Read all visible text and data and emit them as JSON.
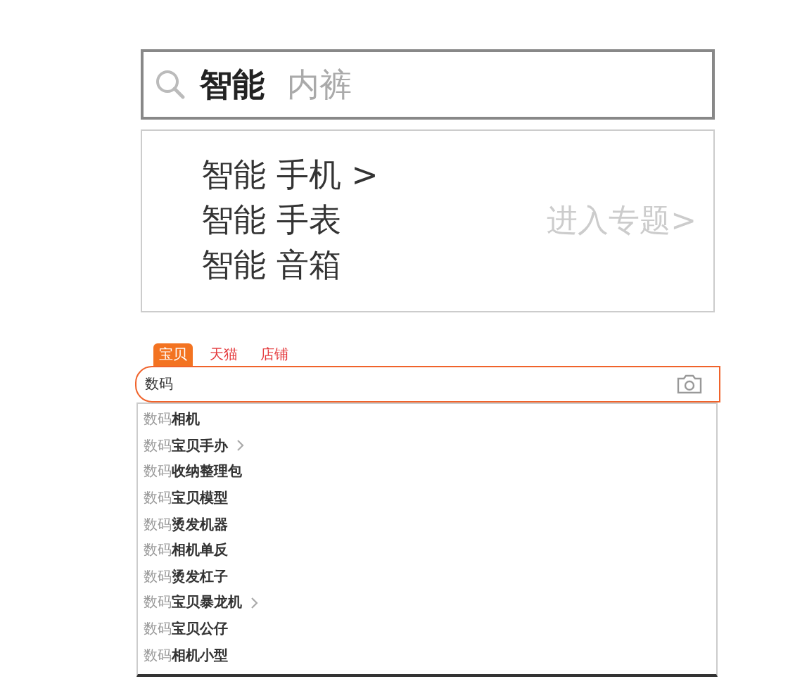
{
  "upper_search": {
    "query": "智能",
    "hint": "内裤"
  },
  "upper_suggestions": {
    "items": [
      {
        "text": "智能 手机 >"
      },
      {
        "text": "智能 手表"
      },
      {
        "text": "智能 音箱"
      }
    ],
    "topic_link": "进入专题>"
  },
  "lower_search": {
    "tabs": [
      {
        "label": "宝贝",
        "selected": true
      },
      {
        "label": "天猫",
        "selected": false
      },
      {
        "label": "店铺",
        "selected": false
      }
    ],
    "value": "数码",
    "suggestions": [
      {
        "text": "数码**相机**",
        "has_more": false
      },
      {
        "text": "数码**宝贝手办**",
        "has_more": true
      },
      {
        "text": "数码**收纳整理包**",
        "has_more": false
      },
      {
        "text": "数码**宝贝模型**",
        "has_more": false
      },
      {
        "text": "数码**烫发机器**",
        "has_more": false
      },
      {
        "text": "数码**相机单反**",
        "has_more": false
      },
      {
        "text": "数码**烫发杠子**",
        "has_more": false
      },
      {
        "text": "数码**宝贝暴龙机**",
        "has_more": true
      },
      {
        "text": "数码**宝贝公仔**",
        "has_more": false
      },
      {
        "text": "数码**相机小型**",
        "has_more": false
      }
    ]
  }
}
